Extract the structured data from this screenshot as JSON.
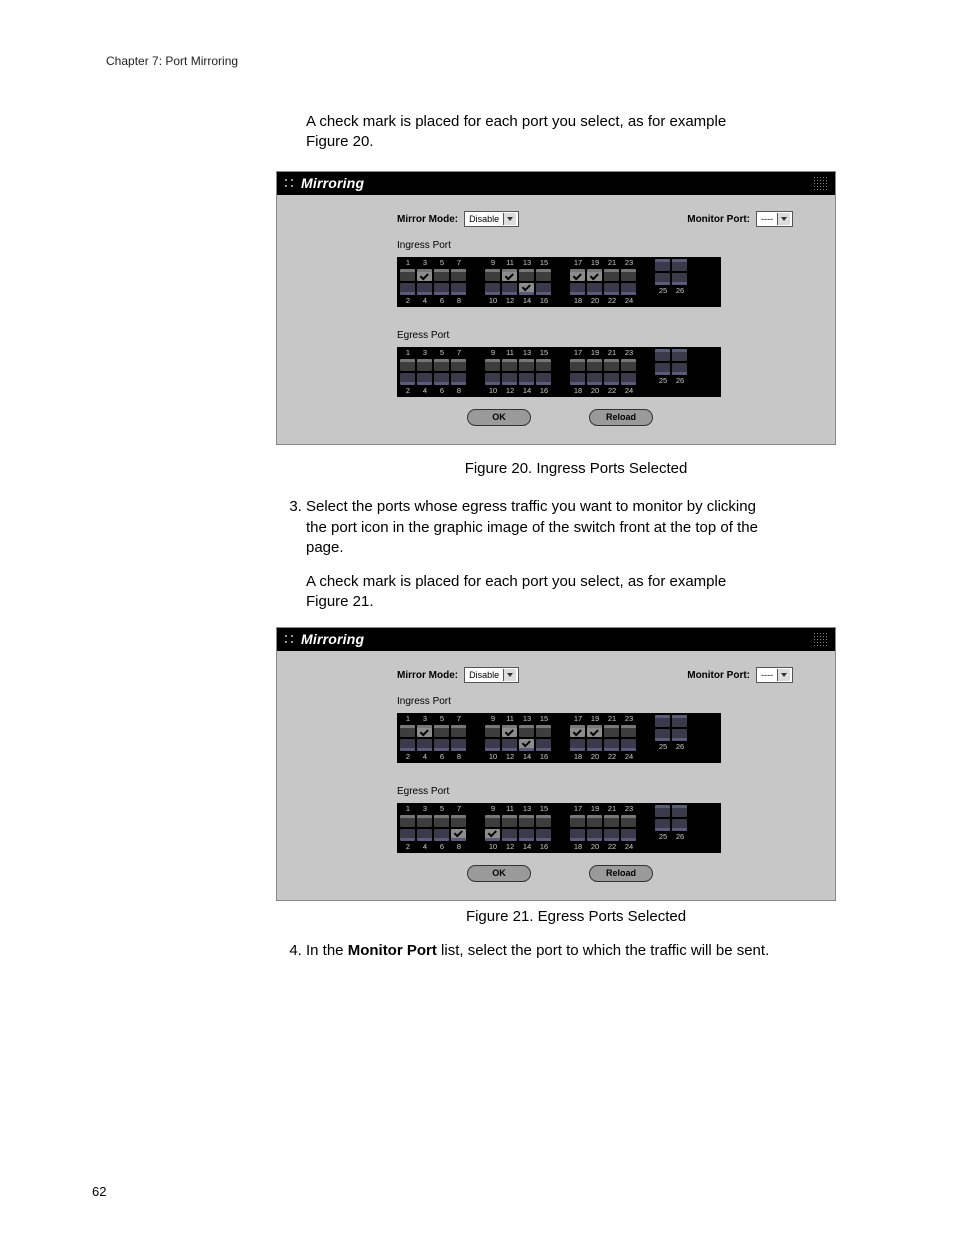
{
  "header": {
    "chapter_line": "Chapter 7: Port Mirroring"
  },
  "intro": {
    "para1_a": "A check mark is placed for each port you select, as for example",
    "para1_b": "Figure 20."
  },
  "fig20": {
    "title": "Mirroring",
    "caption": "Figure 20. Ingress Ports Selected",
    "mirror_mode_label": "Mirror Mode:",
    "mirror_mode_value": "Disable",
    "monitor_port_label": "Monitor Port:",
    "monitor_port_value": "----",
    "ingress_label": "Ingress Port",
    "egress_label": "Egress Port",
    "ok_label": "OK",
    "reload_label": "Reload",
    "ingress_selected": [
      3,
      11,
      14,
      17,
      19
    ],
    "egress_selected": []
  },
  "step3": {
    "line1": "Select the ports whose egress traffic you want to monitor by clicking",
    "line2": "the port icon in the graphic image of the switch front at the top of the",
    "line3": "page.",
    "para2_a": "A check mark is placed for each port you select, as for example",
    "para2_b": "Figure 21."
  },
  "fig21": {
    "title": "Mirroring",
    "caption": "Figure 21. Egress Ports Selected",
    "mirror_mode_label": "Mirror Mode:",
    "mirror_mode_value": "Disable",
    "monitor_port_label": "Monitor Port:",
    "monitor_port_value": "----",
    "ingress_label": "Ingress Port",
    "egress_label": "Egress Port",
    "ok_label": "OK",
    "reload_label": "Reload",
    "ingress_selected": [
      3,
      11,
      14,
      17,
      19
    ],
    "egress_selected": [
      8,
      10
    ]
  },
  "step4": {
    "prefix": "In the ",
    "bold": "Monitor Port",
    "suffix": " list, select the port to which the traffic will be sent."
  },
  "page_number": "62",
  "port_numbers": {
    "g1_top": [
      "1",
      "3",
      "5",
      "7"
    ],
    "g1_bot": [
      "2",
      "4",
      "6",
      "8"
    ],
    "g2_top": [
      "9",
      "11",
      "13",
      "15"
    ],
    "g2_bot": [
      "10",
      "12",
      "14",
      "16"
    ],
    "g3_top": [
      "17",
      "19",
      "21",
      "23"
    ],
    "g3_bot": [
      "18",
      "20",
      "22",
      "24"
    ],
    "g4_top": [
      "",
      ""
    ],
    "g4_bot": [
      "25",
      "26"
    ]
  }
}
